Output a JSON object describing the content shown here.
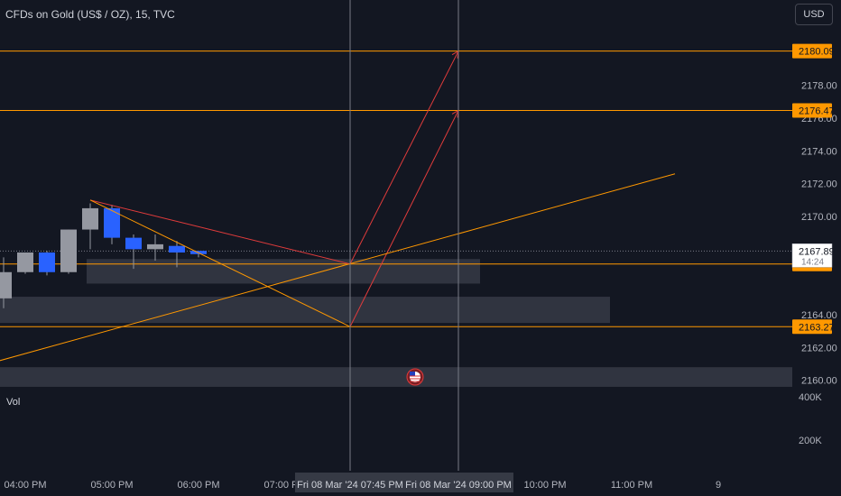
{
  "header": {
    "symbol_title": "CFDs on Gold (US$ / OZ), 15, TVC",
    "currency_button": "USD"
  },
  "volume": {
    "label": "Vol",
    "scale_labels": [
      "400K",
      "200K"
    ]
  },
  "colors": {
    "background": "#131722",
    "up_candle": "#9598a1",
    "down_candle": "#2962ff",
    "level_line": "#ff9800",
    "red_drawing": "#e03b3b",
    "zone": "#363a45",
    "crosshair": "#787b86",
    "axis_text": "#b2b5be"
  },
  "chart_data": {
    "type": "candlestick",
    "price_axis": {
      "range": [
        2158.5,
        2182.5
      ],
      "tick_labels": [
        "2178.00",
        "2176.00",
        "2174.00",
        "2172.00",
        "2170.00",
        "2164.00",
        "2162.00",
        "2160.00"
      ]
    },
    "time_axis": {
      "tick_labels": [
        "04:00 PM",
        "05:00 PM",
        "06:00 PM",
        "07:00 PM",
        "07:45 PM",
        "09:00 PM",
        "10:00 PM",
        "11:00 PM",
        "9"
      ]
    },
    "candles": [
      {
        "time": "03:30 PM",
        "open": 2165.2,
        "high": 2165.7,
        "low": 2164.6,
        "close": 2165.2
      },
      {
        "time": "03:45 PM",
        "open": 2165.0,
        "high": 2167.5,
        "low": 2164.4,
        "close": 2166.6
      },
      {
        "time": "04:00 PM",
        "open": 2166.6,
        "high": 2167.8,
        "low": 2166.5,
        "close": 2167.8
      },
      {
        "time": "04:15 PM",
        "open": 2167.8,
        "high": 2167.9,
        "low": 2166.4,
        "close": 2166.6
      },
      {
        "time": "04:30 PM",
        "open": 2166.6,
        "high": 2169.2,
        "low": 2166.5,
        "close": 2169.2
      },
      {
        "time": "04:45 PM",
        "open": 2169.2,
        "high": 2170.8,
        "low": 2168.0,
        "close": 2170.5
      },
      {
        "time": "05:00 PM",
        "open": 2170.5,
        "high": 2170.7,
        "low": 2168.3,
        "close": 2168.7
      },
      {
        "time": "05:15 PM",
        "open": 2168.7,
        "high": 2168.9,
        "low": 2166.8,
        "close": 2168.0
      },
      {
        "time": "05:30 PM",
        "open": 2168.0,
        "high": 2168.9,
        "low": 2167.3,
        "close": 2168.3
      },
      {
        "time": "05:45 PM",
        "open": 2168.2,
        "high": 2168.5,
        "low": 2166.9,
        "close": 2167.8
      },
      {
        "time": "06:00 PM",
        "open": 2167.9,
        "high": 2167.9,
        "low": 2167.5,
        "close": 2167.7
      }
    ],
    "horizontal_levels": [
      "2180.09",
      "2176.47",
      "2167.10",
      "2163.27"
    ],
    "current_price": {
      "price": "2167.89",
      "countdown": "14:24"
    },
    "crosshair_labels": [
      {
        "date": "Fri 08 Mar '24",
        "time": "07:45 PM"
      },
      {
        "date": "Fri 08 Mar '24",
        "time": "09:00 PM"
      }
    ],
    "zones": [
      {
        "from_time": "04:45 PM",
        "to_time": "09:15 PM",
        "low": 2165.9,
        "high": 2167.4
      },
      {
        "from_time": "03:30 PM",
        "to_time": "10:45 PM",
        "low": 2163.5,
        "high": 2165.1
      },
      {
        "from_time": "03:30 PM",
        "to_time": "end",
        "low": 2159.6,
        "high": 2160.8
      }
    ],
    "drawings": [
      {
        "kind": "trendline",
        "color": "red",
        "points": [
          [
            "04:45 PM",
            2171.0
          ],
          [
            "07:45 PM",
            2167.1
          ],
          [
            "09:00 PM",
            2180.09
          ]
        ]
      },
      {
        "kind": "trendline",
        "color": "orange",
        "points": [
          [
            "04:45 PM",
            2171.0
          ],
          [
            "07:45 PM",
            2163.27
          ]
        ]
      },
      {
        "kind": "trendline",
        "color": "red",
        "points": [
          [
            "07:45 PM",
            2163.27
          ],
          [
            "09:00 PM",
            2176.47
          ]
        ]
      },
      {
        "kind": "trendline",
        "color": "orange",
        "points": [
          [
            "03:30 PM",
            2160.9
          ],
          [
            "11:30 PM",
            2172.6
          ]
        ]
      }
    ],
    "grid": false
  }
}
